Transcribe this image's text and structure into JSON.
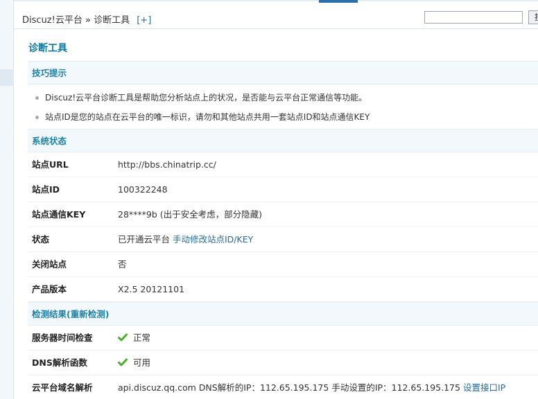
{
  "header": {
    "breadcrumb_root": "Discuz!云平台",
    "breadcrumb_sep": "»",
    "breadcrumb_current": "诊断工具",
    "add_shortcut": "[+]",
    "search_placeholder": "",
    "search_button": "搜"
  },
  "page": {
    "title": "诊断工具"
  },
  "tips": {
    "heading": "技巧提示",
    "items": [
      "Discuz!云平台诊断工具是帮助您分析站点上的状况，是否能与云平台正常通信等功能。",
      "站点ID是您的站点在云平台的唯一标识，请勿和其他站点共用一套站点ID和站点通信KEY"
    ]
  },
  "status": {
    "heading": "系统状态",
    "rows": [
      {
        "label": "站点URL",
        "value": "http://bbs.chinatrip.cc/"
      },
      {
        "label": "站点ID",
        "value": "100322248"
      },
      {
        "label": "站点通信KEY",
        "value": "28****9b (出于安全考虑，部分隐藏)"
      },
      {
        "label": "状态",
        "value": "已开通云平台",
        "link": "手动修改站点ID/KEY"
      },
      {
        "label": "关闭站点",
        "value": "否"
      },
      {
        "label": "产品版本",
        "value": "X2.5 20121101"
      }
    ]
  },
  "check": {
    "heading": "检测结果(重新检测)",
    "rows": [
      {
        "label": "服务器时间检查",
        "value": "正常",
        "icon": "check-icon"
      },
      {
        "label": "DNS解析函数",
        "value": "可用",
        "icon": "check-icon"
      },
      {
        "label": "云平台域名解析",
        "value": "api.discuz.qq.com DNS解析的IP：112.65.195.175 手动设置的IP：112.65.195.175",
        "link": "设置接口IP"
      }
    ]
  },
  "colors": {
    "title": "#0a78a6",
    "section_bg": "#f2f8fc",
    "link": "#1d6aa5",
    "check_green": "#4cae2a"
  }
}
